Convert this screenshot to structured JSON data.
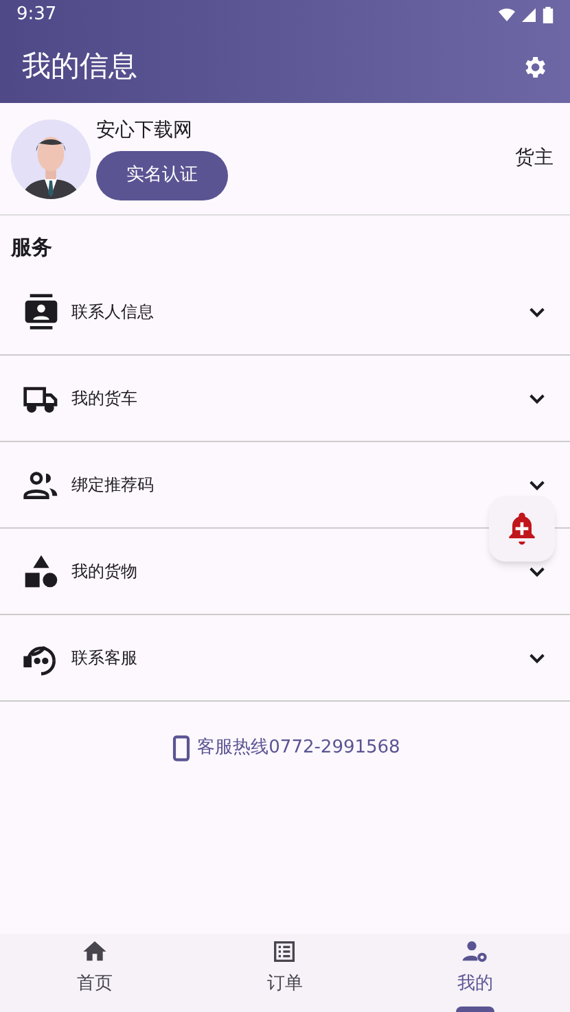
{
  "status_bar": {
    "time": "9:37"
  },
  "header": {
    "title": "我的信息"
  },
  "profile": {
    "name": "安心下载网",
    "verify_button": "实名认证",
    "role": "货主"
  },
  "services": {
    "title": "服务",
    "items": [
      {
        "kind": "contact",
        "label": "联系人信息"
      },
      {
        "kind": "truck",
        "label": "我的货车"
      },
      {
        "kind": "people",
        "label": "绑定推荐码"
      },
      {
        "kind": "shapes",
        "label": "我的货物"
      },
      {
        "kind": "support",
        "label": "联系客服"
      }
    ]
  },
  "hotline": "客服热线0772-2991568",
  "bottom_nav": [
    {
      "kind": "home",
      "label": "首页",
      "selected": false
    },
    {
      "kind": "orders",
      "label": "订单",
      "selected": false
    },
    {
      "kind": "mine",
      "label": "我的",
      "selected": true
    }
  ]
}
